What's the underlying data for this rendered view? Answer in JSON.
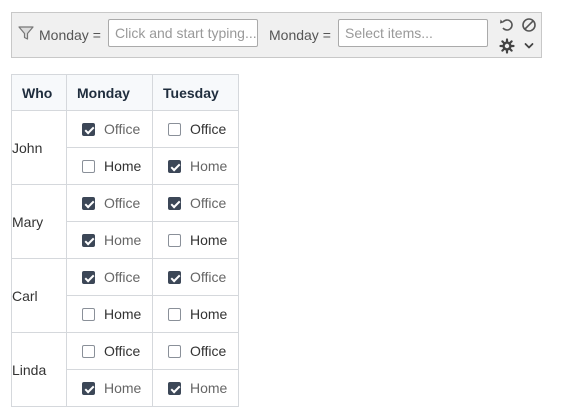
{
  "toolbar": {
    "filter1_label": "Monday =",
    "filter1_placeholder": "Click and start typing...",
    "filter2_label": "Monday =",
    "filter2_placeholder": "Select items..."
  },
  "table": {
    "headers": [
      "Who",
      "Monday",
      "Tuesday"
    ],
    "people": [
      {
        "name": "John",
        "rows": [
          {
            "monday": {
              "label": "Office",
              "checked": true
            },
            "tuesday": {
              "label": "Office",
              "checked": false
            }
          },
          {
            "monday": {
              "label": "Home",
              "checked": false
            },
            "tuesday": {
              "label": "Home",
              "checked": true
            }
          }
        ]
      },
      {
        "name": "Mary",
        "rows": [
          {
            "monday": {
              "label": "Office",
              "checked": true
            },
            "tuesday": {
              "label": "Office",
              "checked": true
            }
          },
          {
            "monday": {
              "label": "Home",
              "checked": true
            },
            "tuesday": {
              "label": "Home",
              "checked": false
            }
          }
        ]
      },
      {
        "name": "Carl",
        "rows": [
          {
            "monday": {
              "label": "Office",
              "checked": true
            },
            "tuesday": {
              "label": "Office",
              "checked": true
            }
          },
          {
            "monday": {
              "label": "Home",
              "checked": false
            },
            "tuesday": {
              "label": "Home",
              "checked": false
            }
          }
        ]
      },
      {
        "name": "Linda",
        "rows": [
          {
            "monday": {
              "label": "Office",
              "checked": false
            },
            "tuesday": {
              "label": "Office",
              "checked": false
            }
          },
          {
            "monday": {
              "label": "Home",
              "checked": true
            },
            "tuesday": {
              "label": "Home",
              "checked": true
            }
          }
        ]
      }
    ]
  },
  "colors": {
    "checkbox_checked": "#3c4757",
    "header_bg": "#f7f9fb",
    "toolbar_bg": "#f0f0f0"
  }
}
